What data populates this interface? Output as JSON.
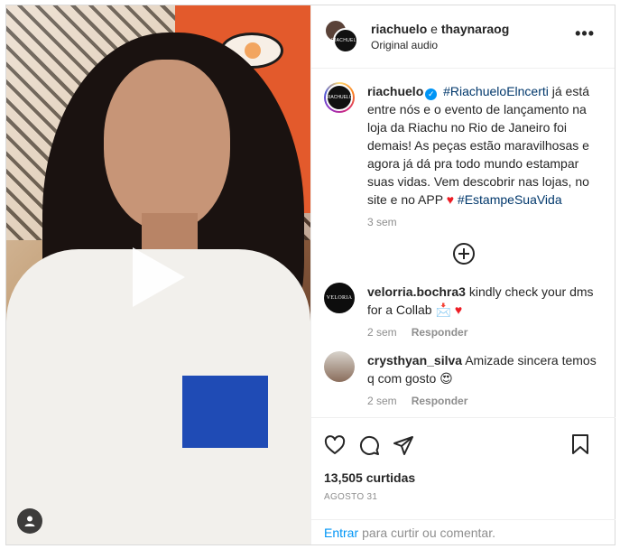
{
  "header": {
    "title_user1": "riachuelo",
    "title_joiner": "e",
    "title_user2": "thaynaraog",
    "audio": "Original audio",
    "avatar_logo": "RIACHUELO"
  },
  "caption": {
    "username": "riachuelo",
    "avatar_logo": "RIACHUELO",
    "hashtag1": "#RiachueloElncerti",
    "text": " já está entre nós e o evento de lançamento na loja da Riachu no Rio de Janeiro foi demais! As peças estão maravilhosas e agora já dá pra todo mundo estampar suas vidas. Vem descobrir nas lojas, no site e no APP ",
    "hashtag2": "#EstampeSuaVida",
    "time": "3 sem"
  },
  "comments": [
    {
      "username": "velorria.bochra3",
      "avatar_logo": "VELORIA",
      "text": " kindly check your dms for a Collab 📩",
      "time": "2 sem",
      "reply": "Responder"
    },
    {
      "username": "crysthyan_silva",
      "text": " Amizade sincera temos q com gosto 😍",
      "time": "2 sem",
      "reply": "Responder"
    }
  ],
  "engagement": {
    "likes": "13,505 curtidas",
    "date": "AGOSTO 31"
  },
  "login": {
    "link": "Entrar",
    "text": "para curtir ou comentar."
  },
  "icons": {
    "like": "heart-icon",
    "comment": "comment-icon",
    "share": "share-icon",
    "save": "bookmark-icon",
    "more": "more-options-icon",
    "play": "play-icon",
    "tag": "user-tag-icon",
    "load_more": "plus-circle-icon"
  }
}
